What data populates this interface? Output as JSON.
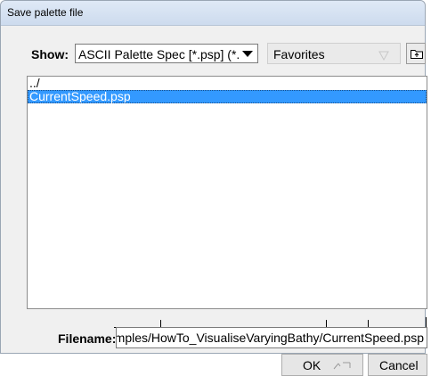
{
  "window": {
    "title": "Save palette file"
  },
  "filter": {
    "label": "Show:",
    "selected": "ASCII Palette Spec [*.psp] (*.p"
  },
  "favorites": {
    "label": "Favorites"
  },
  "file_list": {
    "items": [
      {
        "name": "../",
        "selected": false
      },
      {
        "name": "CurrentSpeed.psp",
        "selected": true
      }
    ]
  },
  "filename": {
    "label": "Filename:",
    "value": "imples/HowTo_VisualiseVaryingBathy/CurrentSpeed.psp"
  },
  "buttons": {
    "ok": "OK",
    "cancel": "Cancel"
  },
  "icons": {
    "filter_dropdown": "triangle-down-icon",
    "favorites": "triangle-down-outline-icon",
    "parent_folder": "folder-up-icon",
    "ok_shortcut": "shortcut-glyph-icon"
  },
  "colors": {
    "selection": "#3399ff",
    "selection_text": "#ffffff"
  }
}
